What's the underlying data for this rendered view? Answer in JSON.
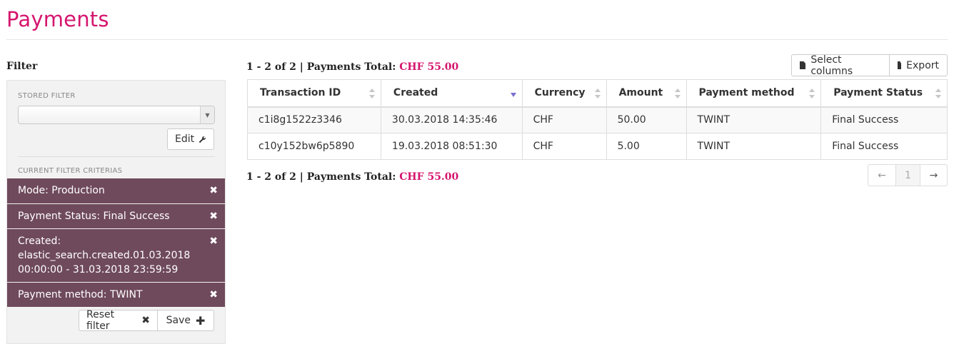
{
  "header": {
    "title": "Payments"
  },
  "sidebar": {
    "heading": "Filter",
    "stored_filter_label": "STORED FILTER",
    "stored_filter_value": "",
    "edit_label": "Edit",
    "criteria_label": "CURRENT FILTER CRITERIAS",
    "criteria": [
      {
        "text": "Mode: Production"
      },
      {
        "text": "Payment Status: Final Success"
      },
      {
        "text": "Created: elastic_search.created.01.03.2018 00:00:00 - 31.03.2018 23:59:59"
      },
      {
        "text": "Payment method: TWINT"
      }
    ],
    "reset_label": "Reset filter",
    "save_label": "Save"
  },
  "main": {
    "summary_prefix": "1 - 2 of 2 | Payments Total:",
    "summary_total": "CHF 55.00",
    "select_columns_label": "Select columns",
    "export_label": "Export",
    "columns": [
      "Transaction ID",
      "Created",
      "Currency",
      "Amount",
      "Payment method",
      "Payment Status"
    ],
    "rows": [
      [
        "c1i8g1522z3346",
        "30.03.2018 14:35:46",
        "CHF",
        "50.00",
        "TWINT",
        "Final Success"
      ],
      [
        "c10y152bw6p5890",
        "19.03.2018 08:51:30",
        "CHF",
        "5.00",
        "TWINT",
        "Final Success"
      ]
    ],
    "pagination": {
      "prev": "←",
      "current": "1",
      "next": "→"
    }
  },
  "colors": {
    "brand": "#d5156e",
    "criteria_bg": "#6f4a5c",
    "sort_active": "#7a6fd0"
  }
}
